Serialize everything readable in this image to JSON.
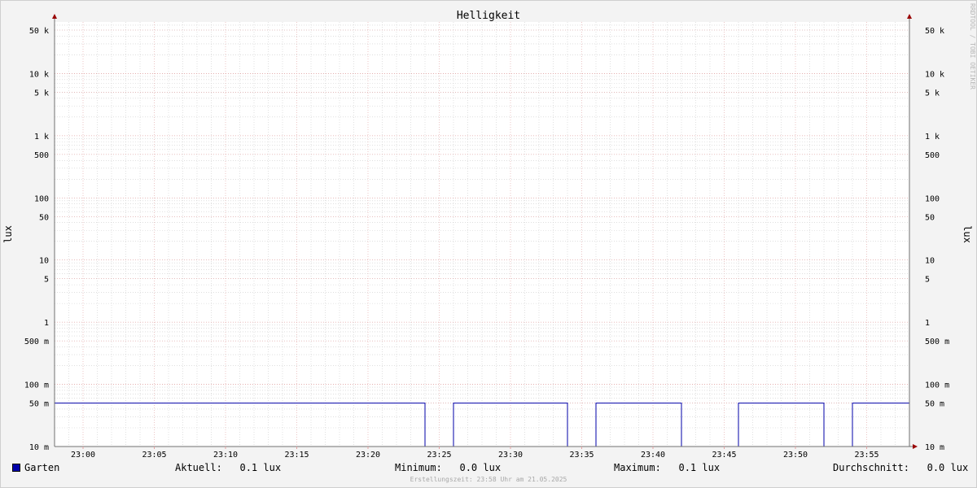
{
  "chart_data": {
    "type": "line",
    "title": "Helligkeit",
    "ylabel": "lux",
    "y_scale": "log",
    "ylim": [
      0.01,
      80000
    ],
    "x_ticks": [
      "23:00",
      "23:05",
      "23:10",
      "23:15",
      "23:20",
      "23:25",
      "23:30",
      "23:35",
      "23:40",
      "23:45",
      "23:50",
      "23:55"
    ],
    "y_ticks": [
      {
        "value": 0.01,
        "label": "10 m"
      },
      {
        "value": 0.05,
        "label": "50 m"
      },
      {
        "value": 0.1,
        "label": "100 m"
      },
      {
        "value": 0.5,
        "label": "500 m"
      },
      {
        "value": 1,
        "label": "1"
      },
      {
        "value": 5,
        "label": "5"
      },
      {
        "value": 10,
        "label": "10"
      },
      {
        "value": 50,
        "label": "50"
      },
      {
        "value": 100,
        "label": "100"
      },
      {
        "value": 500,
        "label": "500"
      },
      {
        "value": 1000,
        "label": "1 k"
      },
      {
        "value": 5000,
        "label": "5 k"
      },
      {
        "value": 10000,
        "label": "10 k"
      },
      {
        "value": 50000,
        "label": "50 k"
      }
    ],
    "grid": true,
    "legend_position": "bottom",
    "series": [
      {
        "name": "Garten",
        "color": "#0000aa",
        "points": [
          [
            "22:58",
            0.05
          ],
          [
            "23:24",
            0.05
          ],
          [
            "23:24",
            0.01
          ],
          [
            "23:26",
            0.01
          ],
          [
            "23:26",
            0.05
          ],
          [
            "23:34",
            0.05
          ],
          [
            "23:34",
            0.01
          ],
          [
            "23:36",
            0.01
          ],
          [
            "23:36",
            0.05
          ],
          [
            "23:42",
            0.05
          ],
          [
            "23:42",
            0.01
          ],
          [
            "23:46",
            0.01
          ],
          [
            "23:46",
            0.05
          ],
          [
            "23:52",
            0.05
          ],
          [
            "23:52",
            0.01
          ],
          [
            "23:54",
            0.01
          ],
          [
            "23:54",
            0.05
          ],
          [
            "23:58",
            0.05
          ]
        ]
      }
    ]
  },
  "legend": {
    "series_name": "Garten",
    "aktuell": "Aktuell:   0.1 lux",
    "minimum": "Minimum:   0.0 lux",
    "maximum": "Maximum:   0.1 lux",
    "durchschnitt": "Durchschnitt:   0.0 lux"
  },
  "footer": "Erstellungszeit: 23:58 Uhr am 21.05.2025",
  "watermark": "RRDTOOL / TOBI OETIKER",
  "colors": {
    "background": "#f3f3f3",
    "plot_background": "#ffffff",
    "major_grid": "#e0a0a0",
    "minor_grid": "#cccccc",
    "axis": "#707070",
    "arrow": "#990000",
    "series": "#0000aa"
  }
}
